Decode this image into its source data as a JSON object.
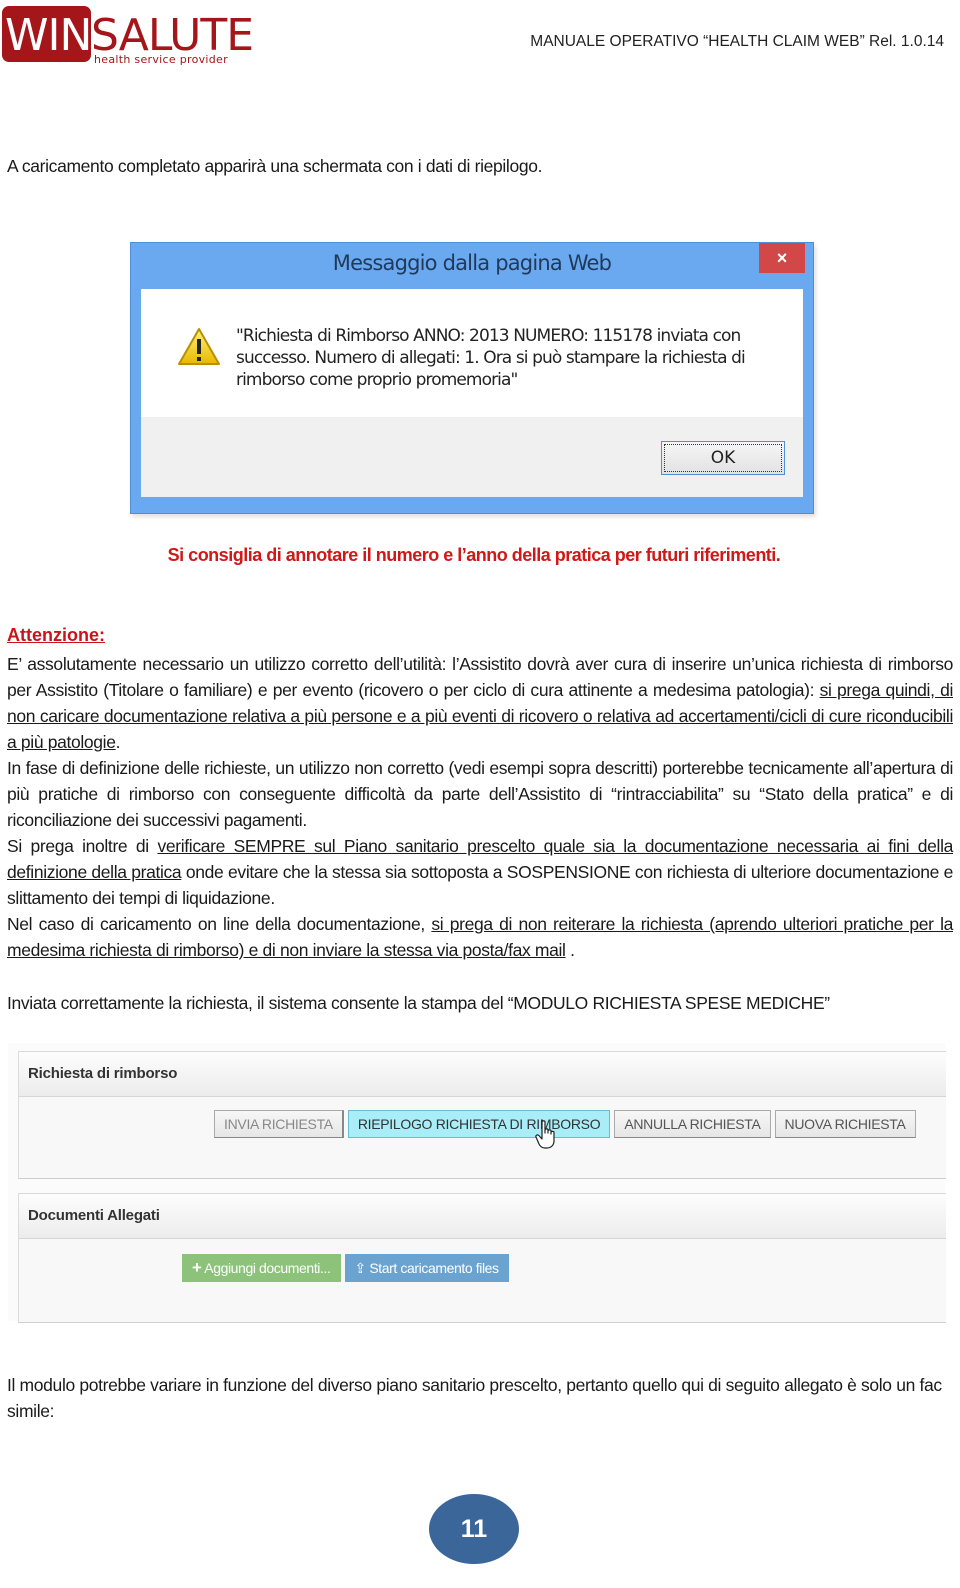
{
  "header": {
    "logo_primary": "WIN",
    "logo_secondary": "SALUTE",
    "logo_tagline": "health service provider",
    "document_title": "MANUALE OPERATIVO “HEALTH CLAIM WEB” Rel. 1.0.14"
  },
  "intro_text": "A caricamento completato apparirà una schermata con i dati di riepilogo.",
  "dialog": {
    "title": "Messaggio dalla pagina Web",
    "close_label": "×",
    "icon": "warning-icon",
    "message": "\"Richiesta di Rimborso ANNO: 2013 NUMERO: 115178 inviata con successo. Numero di allegati: 1. Ora si può stampare la richiesta di rimborso come proprio promemoria\"",
    "ok_label": "OK"
  },
  "advice": "Si consiglia di annotare il numero e l’anno della pratica per futuri riferimenti.",
  "attention": {
    "heading": "Attenzione:",
    "p1_a": "E’ assolutamente necessario un utilizzo corretto dell’utilità: l’Assistito dovrà aver cura di inserire un’unica richiesta di rimborso per Assistito (Titolare o familiare) e per evento (ricovero o per ciclo di cura attinente a medesima patologia): ",
    "p1_u": "si prega quindi, di non caricare documentazione relativa a più persone e  a più eventi di ricovero o relativa ad accertamenti/cicli di cure riconducibili a più patologie",
    "p1_end": ".",
    "p2": "In fase di definizione delle richieste, un utilizzo non corretto (vedi esempi sopra descritti) porterebbe tecnicamente all’apertura di più pratiche di rimborso con conseguente difficoltà da parte dell’Assistito di “rintracciabilita” su “Stato della pratica” e  di riconciliazione dei successivi pagamenti.",
    "p3_a": "Si prega inoltre di ",
    "p3_u": "verificare SEMPRE sul Piano sanitario prescelto quale sia la documentazione necessaria ai fini della definizione della pratica",
    "p3_b": " onde evitare che la stessa sia sottoposta a SOSPENSIONE con richiesta di ulteriore documentazione e slittamento dei tempi di liquidazione.",
    "p4_a": "Nel caso di caricamento on line della documentazione, ",
    "p4_u": "si prega di non reiterare la richiesta (aprendo ulteriori pratiche per la medesima richiesta di rimborso) e di non inviare la stessa via posta/fax mail",
    "p4_end": " ."
  },
  "print_text": "Inviata correttamente la richiesta, il sistema consente la stampa del “MODULO RICHIESTA SPESE MEDICHE”",
  "app": {
    "request_panel": {
      "title": "Richiesta di rimborso",
      "buttons": [
        {
          "label": "INVIA RICHIESTA",
          "state": "disabled"
        },
        {
          "label": "RIEPILOGO RICHIESTA DI RIMBORSO",
          "state": "hover"
        },
        {
          "label": "ANNULLA RICHIESTA",
          "state": "normal"
        },
        {
          "label": "NUOVA RICHIESTA",
          "state": "normal"
        }
      ]
    },
    "documents_panel": {
      "title": "Documenti Allegati",
      "add_button": {
        "label": "Aggiungi documenti...",
        "icon": "plus-icon",
        "color": "#8dc27a"
      },
      "upload_button": {
        "label": "Start caricamento files",
        "icon": "upload-icon",
        "color": "#6aa3cf"
      }
    }
  },
  "closing_text": "Il modulo potrebbe variare in funzione del diverso piano sanitario prescelto, pertanto quello qui di seguito allegato è solo un fac simile:",
  "page_number": "11",
  "colors": {
    "brand_red": "#a4161a",
    "advice_red": "#d01818",
    "page_badge": "#3b669a"
  }
}
